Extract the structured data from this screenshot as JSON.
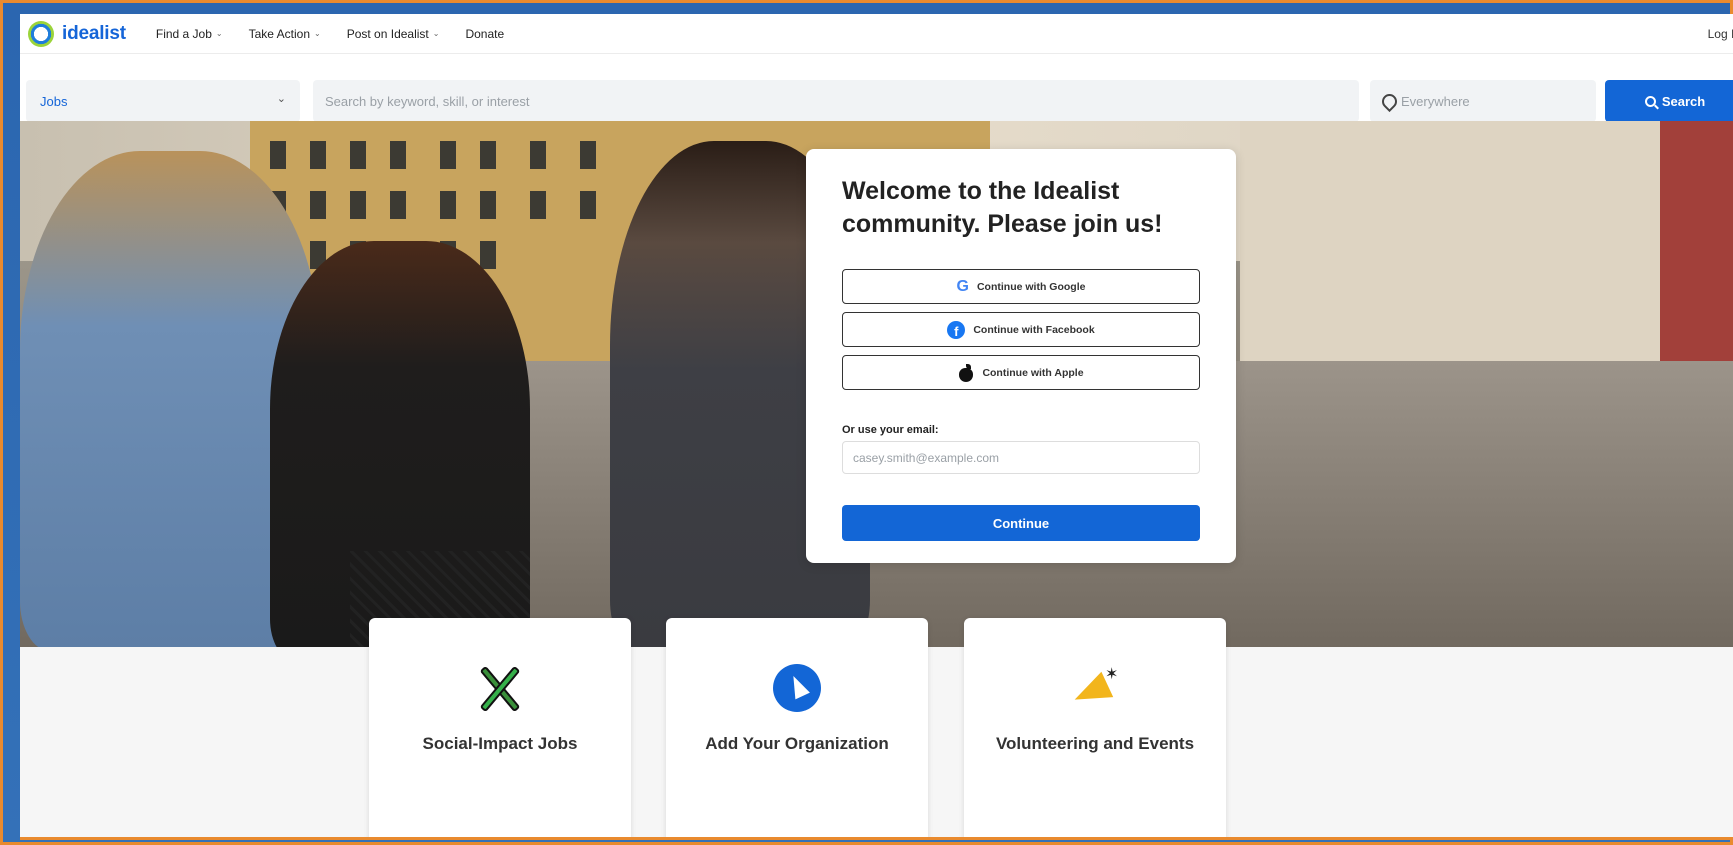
{
  "nav": {
    "brand": "idealist",
    "items": [
      {
        "label": "Find a Job"
      },
      {
        "label": "Take Action"
      },
      {
        "label": "Post on Idealist"
      },
      {
        "label": "Donate"
      }
    ],
    "login": "Log In"
  },
  "search": {
    "category": "Jobs",
    "keyword_placeholder": "Search by keyword, skill, or interest",
    "location_placeholder": "Everywhere",
    "button": "Search"
  },
  "signup": {
    "title": "Welcome to the Idealist community. Please join us!",
    "google": "Continue with Google",
    "facebook": "Continue with Facebook",
    "apple": "Continue with Apple",
    "email_label": "Or use your email:",
    "email_placeholder": "casey.smith@example.com",
    "continue": "Continue"
  },
  "features": [
    {
      "title": "Social-Impact Jobs",
      "icon": "tools-icon"
    },
    {
      "title": "Add Your Organization",
      "icon": "cursor-click-icon"
    },
    {
      "title": "Volunteering and Events",
      "icon": "megaphone-icon"
    }
  ],
  "colors": {
    "brand_blue": "#1366d6",
    "frame_blue": "#2f6ab1",
    "frame_orange": "#e98a2e"
  }
}
